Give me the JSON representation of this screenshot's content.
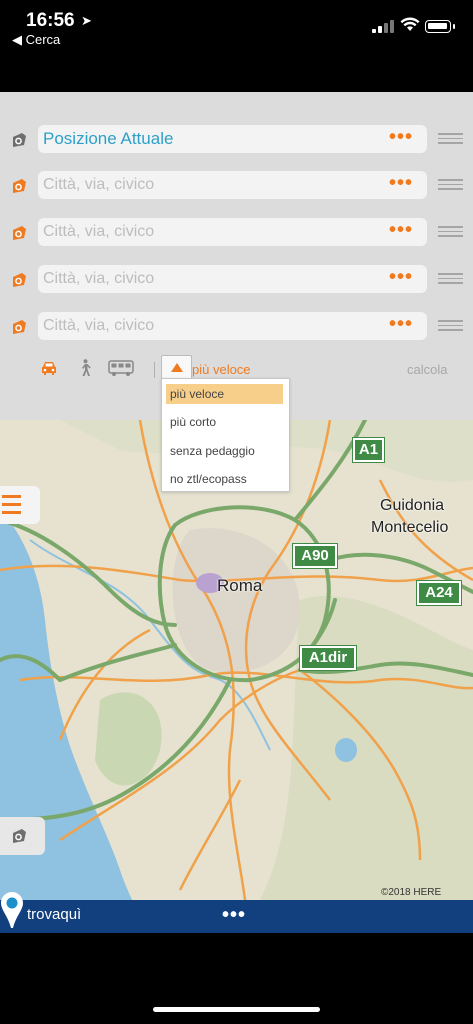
{
  "status_bar": {
    "time": "16:56",
    "back_label": "◀ Cerca"
  },
  "route": {
    "fields": [
      {
        "value": "Posizione Attuale",
        "placeholder": "",
        "active": true
      },
      {
        "value": "",
        "placeholder": "Città, via, civico",
        "active": false
      },
      {
        "value": "",
        "placeholder": "Città, via, civico",
        "active": false
      },
      {
        "value": "",
        "placeholder": "Città, via, civico",
        "active": false
      },
      {
        "value": "",
        "placeholder": "Città, via, civico",
        "active": false
      }
    ],
    "more_glyph": "•••",
    "route_type_selected": "più veloce",
    "calc_label": "calcola",
    "options": [
      "più veloce",
      "più corto",
      "senza pedaggio",
      "no ztl/ecopass"
    ]
  },
  "map": {
    "city_label": "Roma",
    "town_label_1": "Guidonia",
    "town_label_2": "Montecelio",
    "road_shields": [
      "A1",
      "A90",
      "A24",
      "A1dir"
    ],
    "copyright": "©2018 HERE"
  },
  "bottom_bar": {
    "brand": "trovaquì",
    "more_glyph": "•••"
  },
  "colors": {
    "accent": "#f07a1f",
    "active_text": "#2ca0c9",
    "bottom_bar": "#12407f",
    "sea": "#8fc1e0",
    "land": "#e6e2cf",
    "motorway": "#7aa86a",
    "road": "#f0a14a"
  },
  "icons": {
    "origin": "location-pin-grey-icon",
    "waypoint": "location-pin-orange-icon",
    "car": "car-icon",
    "walk": "pedestrian-icon",
    "bus": "bus-icon",
    "reorder": "drag-handle-icon",
    "menu": "hamburger-menu-icon",
    "locate": "my-location-icon"
  }
}
